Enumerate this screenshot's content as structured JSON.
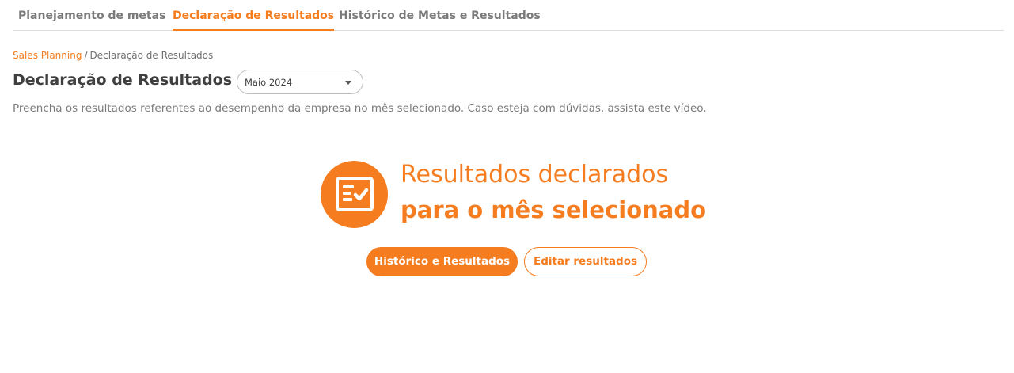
{
  "tabs": [
    {
      "label": "Planejamento de metas",
      "active": false
    },
    {
      "label": "Declaração de Resultados",
      "active": true
    },
    {
      "label": "Histórico de Metas e Resultados",
      "active": false
    }
  ],
  "breadcrumb": {
    "root": "Sales Planning",
    "separator": "/",
    "current": "Declaração de Resultados"
  },
  "page": {
    "title": "Declaração de Resultados",
    "month_select": {
      "value": "Maio 2024"
    },
    "description": "Preencha os resultados referentes ao desempenho da empresa no mês selecionado. Caso esteja com dúvidas, assista este vídeo."
  },
  "status": {
    "icon": "checklist-form-icon",
    "line1": "Resultados declarados",
    "line2": "para o mês selecionado"
  },
  "actions": {
    "primary_label": "Histórico e Resultados",
    "secondary_label": "Editar resultados"
  },
  "colors": {
    "accent": "#f57c1f",
    "text": "#4a4a4a",
    "muted": "#7a7a7a",
    "divider": "#dcdcdc"
  }
}
